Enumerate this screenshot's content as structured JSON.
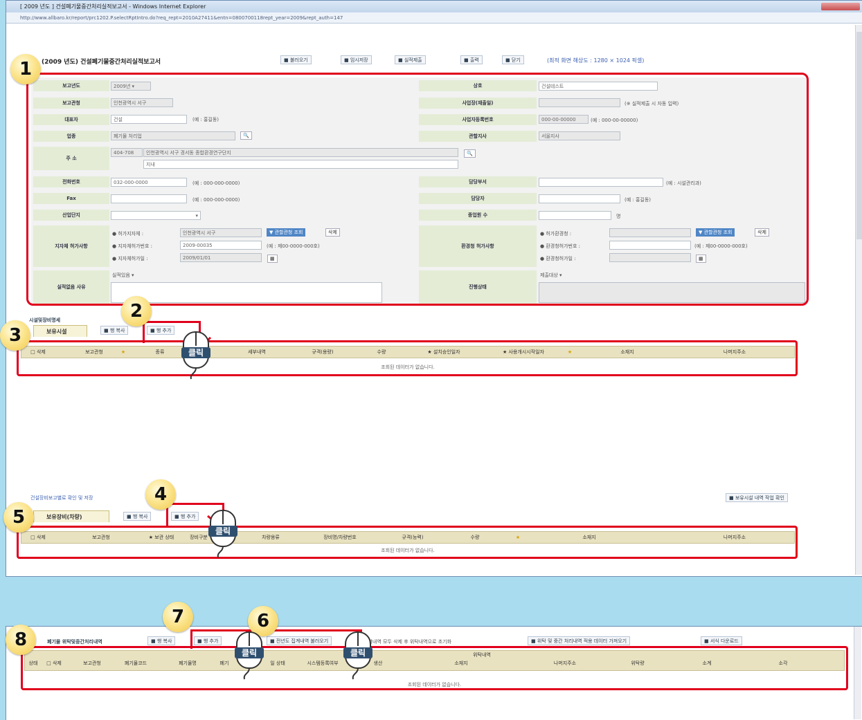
{
  "window": {
    "title": "[ 2009 년도 ] 건설폐기물중간처리실적보고서 - Windows Internet Explorer",
    "address": "http://www.allbaro.kr/report/prc1202.P.selectRptIntro.do?req_rept=2010A27411&entn=0800700118rept_year=2009&rept_auth=147"
  },
  "form": {
    "title": "(2009 년도) 건설폐기물중간처리실적보고서",
    "toolbar": [
      "불러오기",
      "임시저장",
      "실적제출",
      "출력",
      "닫기"
    ],
    "resolution_hint": "(최적 화면 해상도 : 1280 × 1024 픽셀)",
    "fields": {
      "report_year_label": "보고년도",
      "report_year_value": "2009년",
      "report_office_label": "보고관청",
      "report_office_value": "인천광역시 서구",
      "ceo_label": "대표자",
      "ceo_value": "건설",
      "ceo_hint": "(예 : 홍길동)",
      "business_label": "업종",
      "business_value": "폐기물 처리업",
      "address_label": "주 소",
      "address_zip": "404-708",
      "address_value": "인천광역시 서구 경서동 종합환경연구단지",
      "address_detail": "지내",
      "phone_label": "전화번호",
      "phone_value": "032-000-0000",
      "phone_hint": "(예 : 000-000-0000)",
      "fax_label": "Fax",
      "fax_hint": "(예 : 000-000-0000)",
      "complex_label": "산업단지",
      "permit_label": "지자체 허가사항",
      "permit_1": "● 허가지자체 :",
      "permit_1_value": "인천광역시 서구",
      "permit_btn": "▼ 관할관청 조회",
      "permit_del": "삭제",
      "permit_2": "● 지자체허가번호 :",
      "permit_2_value": "2009-00035",
      "permit_2_hint": "(예 : 제00-0000-000호)",
      "permit_3": "● 지자체허가일 :",
      "permit_3_value": "2009/01/01",
      "noreason_label": "실적없음 사유",
      "noreason_value": "실적있음",
      "company_label": "상호",
      "company_value": "건설테스트",
      "biz_date_label": "사업장(재출일)",
      "biz_date_hint": "(※ 실적제출 시 자동 입력)",
      "bizno_label": "사업자등록번호",
      "bizno_value": "000-00-00000",
      "bizno_hint": "(예 : 000-00-00000)",
      "office_label": "관할지사",
      "office_value": "서울지사",
      "dept_label": "담당부서",
      "dept_hint": "(예 : 시설관리과)",
      "staff_label": "담당자",
      "staff_hint": "(예 : 홍길동)",
      "employees_label": "종업원 수",
      "employees_unit": "명",
      "env_label": "환경청 허가사항",
      "env_1": "● 허가환경청 :",
      "env_btn": "▼ 관할관청 조회",
      "env_del": "삭제",
      "env_2": "● 환경청허가번호 :",
      "env_2_hint": "(예 : 제00-0000-000호)",
      "env_3": "● 환경청허가일 :",
      "progress_label": "진행상태",
      "progress_value": "제출대상"
    }
  },
  "section1": {
    "title": "시설및장비명세",
    "tab": "보유시설",
    "buttons": [
      "행 복사",
      "행 추가"
    ],
    "columns": [
      "□ 삭제",
      "보고관청",
      "★",
      "종류",
      "",
      "세부내역",
      "규격(용량)",
      "수량",
      "★ 설치승인일자",
      "★ 사용개시시작일자",
      "★",
      "소재지",
      "나머지주소"
    ],
    "empty": "조회된 데이터가 없습니다."
  },
  "section2": {
    "link": "건설장비보고별로 확인 및 저장",
    "tab": "보유장비(차량)",
    "buttons": [
      "행 복사",
      "행 추가"
    ],
    "right_button": "보유시설 내역 작업 확인",
    "columns": [
      "□ 삭제",
      "보고관청",
      "★ 보관 상태",
      "장비구분",
      "차량용류",
      "장비명/차량번호",
      "규격(능력)",
      "수량",
      "★",
      "소재지",
      "나머지주소"
    ],
    "empty": "조회된 데이터가 없습니다."
  },
  "section3": {
    "title": "폐기물 위탁및중간처리내역",
    "buttons": [
      "행 복사",
      "행 추가"
    ],
    "import_btn": "전년도 집계내역 불러오기",
    "note": "입력내역 모두 삭제 후 위탁내역으로 초기화",
    "btn2": "위탁 및 중간 처리내역 적용 데이터 가져오기",
    "btn3": "서식 다운로드",
    "group": "위탁내역",
    "columns": [
      "상태",
      "□ 삭제",
      "보고관청",
      "폐기물코드",
      "폐기물명",
      "폐기",
      "",
      "일 상태",
      "시스템등록여부",
      "생산",
      "소재지",
      "나머지주소",
      "위탁량",
      "소계",
      "소각"
    ],
    "empty": "조회된 데이터가 없습니다."
  },
  "callouts": [
    "1",
    "2",
    "3",
    "4",
    "5",
    "6",
    "7",
    "8"
  ],
  "click_label": "클릭"
}
